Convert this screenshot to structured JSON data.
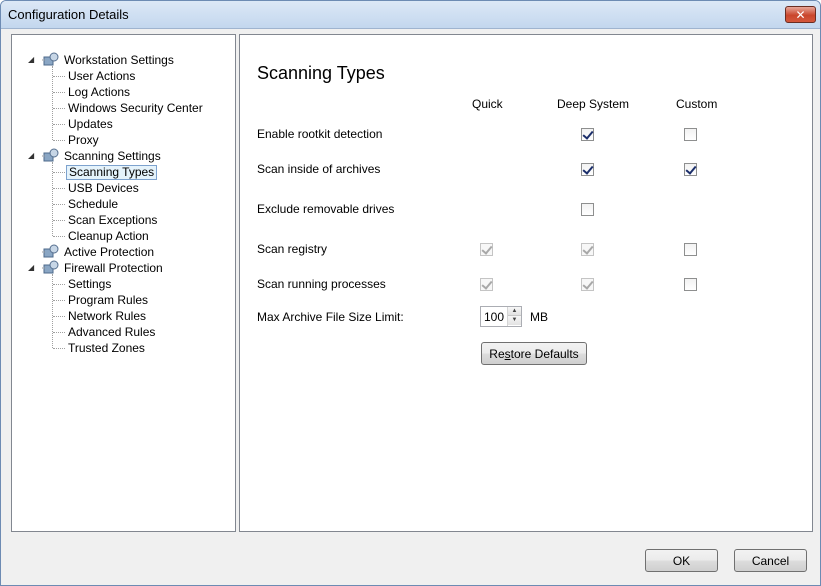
{
  "window": {
    "title": "Configuration Details",
    "close_glyph": "✕"
  },
  "tree": {
    "groups": [
      {
        "label": "Workstation Settings",
        "icon": "workstation-settings-icon",
        "children": [
          "User Actions",
          "Log Actions",
          "Windows Security Center",
          "Updates",
          "Proxy"
        ]
      },
      {
        "label": "Scanning Settings",
        "icon": "scanning-settings-icon",
        "children": [
          "Scanning Types",
          "USB Devices",
          "Schedule",
          "Scan Exceptions",
          "Cleanup Action"
        ]
      },
      {
        "label": "Active Protection",
        "icon": "active-protection-icon",
        "children": []
      },
      {
        "label": "Firewall Protection",
        "icon": "firewall-protection-icon",
        "children": [
          "Settings",
          "Program Rules",
          "Network Rules",
          "Advanced Rules",
          "Trusted Zones"
        ]
      }
    ],
    "selected": "Scanning Types"
  },
  "content": {
    "title": "Scanning Types",
    "columns": [
      "Quick",
      "Deep System",
      "Custom"
    ],
    "rows": [
      {
        "label": "Enable rootkit detection",
        "quick": null,
        "deep": {
          "checked": true,
          "disabled": false
        },
        "custom": {
          "checked": false,
          "disabled": false
        }
      },
      {
        "label": "Scan inside of archives",
        "quick": null,
        "deep": {
          "checked": true,
          "disabled": false
        },
        "custom": {
          "checked": true,
          "disabled": false
        }
      },
      {
        "label": "Exclude removable drives",
        "quick": null,
        "deep": {
          "checked": false,
          "disabled": false
        },
        "custom": null
      },
      {
        "label": "Scan registry",
        "quick": {
          "checked": true,
          "disabled": true
        },
        "deep": {
          "checked": true,
          "disabled": true
        },
        "custom": {
          "checked": false,
          "disabled": false
        }
      },
      {
        "label": "Scan running processes",
        "quick": {
          "checked": true,
          "disabled": true
        },
        "deep": {
          "checked": true,
          "disabled": true
        },
        "custom": {
          "checked": false,
          "disabled": false
        }
      }
    ],
    "max_archive": {
      "label": "Max Archive File Size Limit:",
      "value": "100",
      "unit": "MB"
    },
    "restore_button": {
      "pre": "Re",
      "accel": "s",
      "post": "tore Defaults"
    }
  },
  "footer": {
    "ok_label": "OK",
    "cancel_label": "Cancel"
  }
}
